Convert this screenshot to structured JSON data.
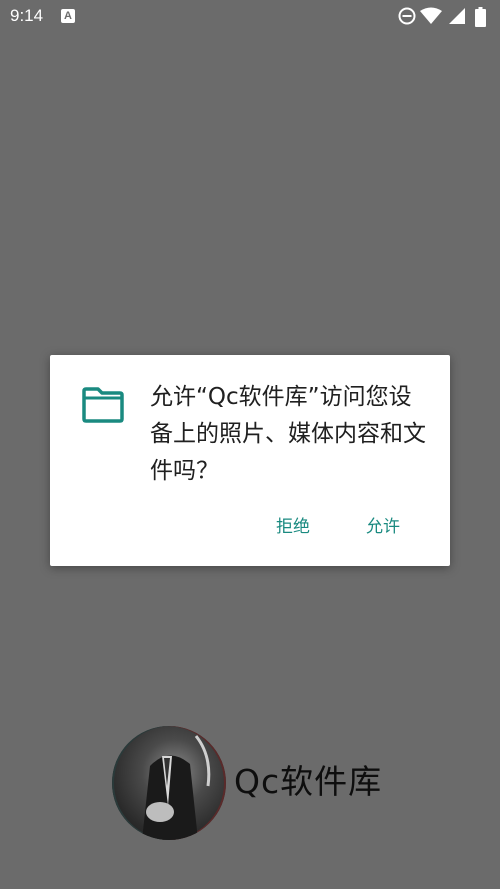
{
  "status_bar": {
    "time": "9:14",
    "notification_icon_letter": "A",
    "icons": [
      "notification-a-icon",
      "do-not-disturb-icon",
      "wifi-icon",
      "signal-icon",
      "battery-icon"
    ]
  },
  "dialog": {
    "icon": "folder-icon",
    "accent_color": "#1a8a80",
    "message": "允许“Qc软件库”访问您设备上的照片、媒体内容和文件吗？",
    "deny_label": "拒绝",
    "allow_label": "允许"
  },
  "splash": {
    "brand_name": "Qc软件库",
    "logo": "avatar-logo"
  }
}
